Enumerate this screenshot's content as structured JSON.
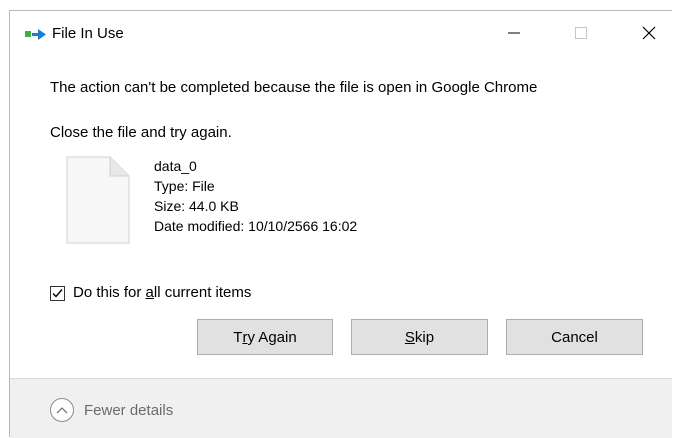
{
  "window": {
    "title": "File In Use"
  },
  "message": {
    "line1": "The action can't be completed because the file is open in Google Chrome",
    "line2": "Close the file and try again."
  },
  "file": {
    "name": "data_0",
    "type": "Type: File",
    "size": "Size: 44.0 KB",
    "date_modified": "Date modified: 10/10/2566 16:02",
    "icon": "blank-file-icon"
  },
  "checkbox": {
    "checked": true,
    "label_prefix": "Do this for ",
    "label_accel": "a",
    "label_suffix": "ll current items"
  },
  "buttons": {
    "try_again": {
      "before": "T",
      "accel": "r",
      "after": "y Again"
    },
    "skip": {
      "before": "",
      "accel": "S",
      "after": "kip"
    },
    "cancel": "Cancel"
  },
  "footer": {
    "details_label": "Fewer details"
  },
  "colors": {
    "accent_blue": "#1a7fd4",
    "icon_green": "#3fae49",
    "button_bg": "#e1e1e1",
    "footer_bg": "#f0f0f0"
  }
}
